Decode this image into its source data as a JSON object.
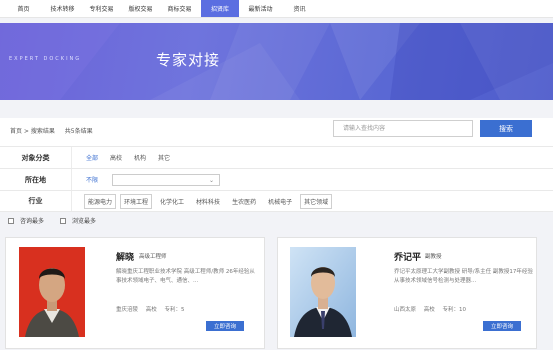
{
  "nav": {
    "items": [
      "首页",
      "技术转移",
      "专利交易",
      "版权交易",
      "商标交易",
      "招贤库",
      "最新活动",
      "资讯"
    ],
    "active_index": 5
  },
  "banner": {
    "subtitle": "EXPERT DOCKING",
    "title": "专家对接"
  },
  "breadcrumb": {
    "path": "首页 > 搜索结果",
    "count": "共5条结果"
  },
  "search": {
    "placeholder": "请输入查找内容",
    "button": "搜索"
  },
  "filters": {
    "object": {
      "label": "对象分类",
      "options": [
        "全部",
        "高校",
        "机构",
        "其它"
      ]
    },
    "location": {
      "label": "所在地",
      "option": "不限"
    },
    "industry": {
      "label": "行业",
      "options": [
        "能源电力",
        "环境工程",
        "化学化工",
        "材料科技",
        "生农医药",
        "机械电子",
        "其它领域"
      ]
    }
  },
  "sort": {
    "consult": "咨询最多",
    "browse": "浏览最多"
  },
  "experts": [
    {
      "name": "解晓",
      "title": "高级工程师",
      "intro": "解晓重庆工程职业技术学院 高级工程师/教师 26年经验从事技术领域电子、电气、通信、...",
      "location": "重庆涪陵",
      "type": "高校",
      "patents": "专利：5",
      "button": "立即咨询"
    },
    {
      "name": "乔记平",
      "title": "副教授",
      "intro": "乔记平太原理工大学副教授 研导/系主任 副教授17年经验从事技术领域信号检测与处理器...",
      "location": "山西太原",
      "type": "高校",
      "patents": "专利：10",
      "button": "立即咨询"
    }
  ],
  "colors": {
    "accent": "#3b6fd1",
    "banner": "#6b63d8",
    "nav_active": "#5b6ee1"
  }
}
